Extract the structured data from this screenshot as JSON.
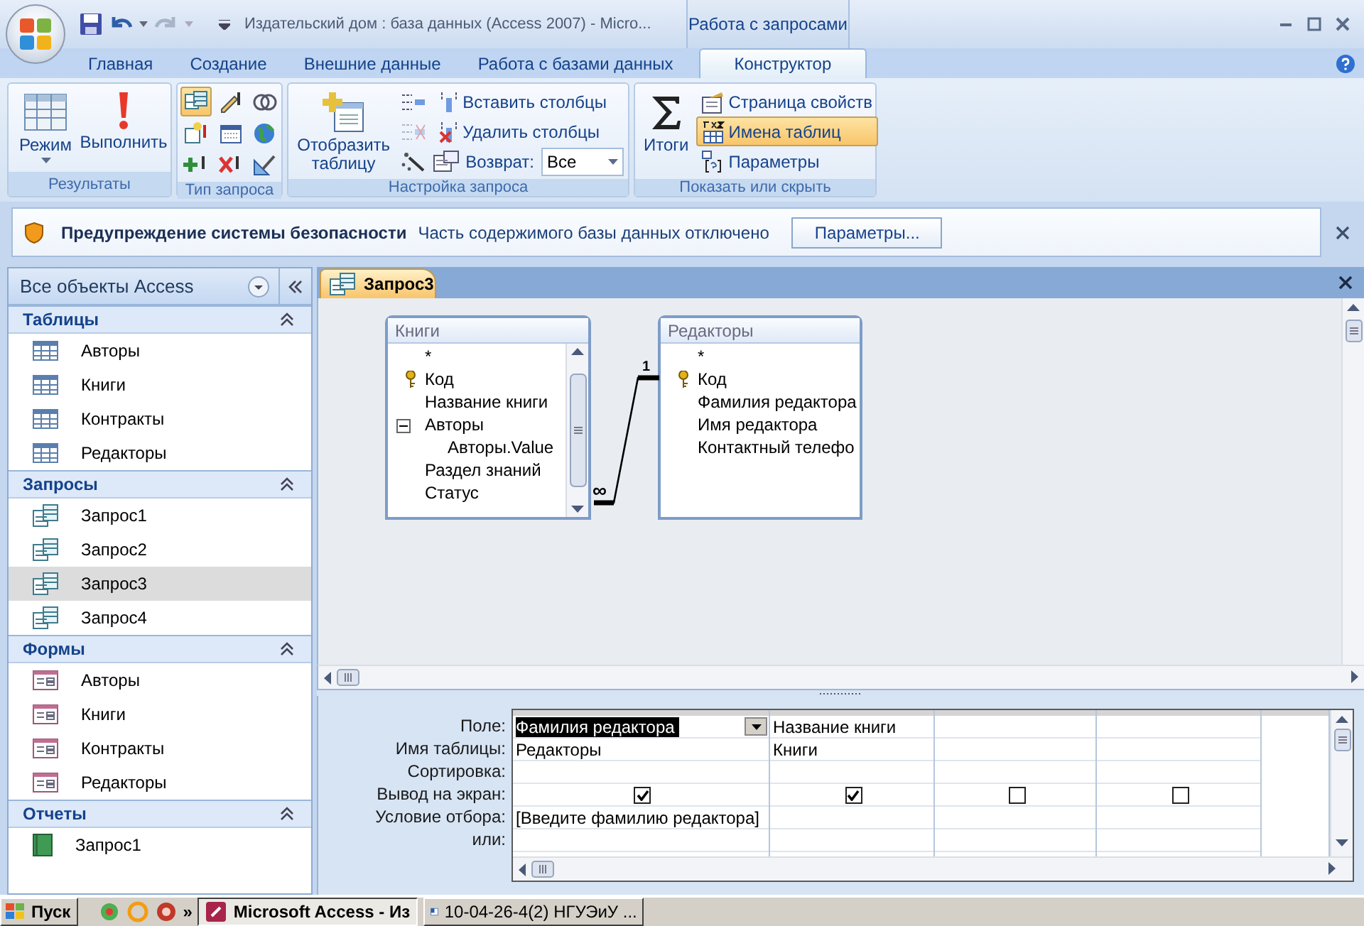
{
  "window": {
    "title": "Издательский дом : база данных (Access 2007) - Micro...",
    "context_group": "Работа с запросами"
  },
  "ribbon_tabs": [
    {
      "label": "Главная",
      "selected": false
    },
    {
      "label": "Создание",
      "selected": false
    },
    {
      "label": "Внешние данные",
      "selected": false
    },
    {
      "label": "Работа с базами данных",
      "selected": false
    },
    {
      "label": "Конструктор",
      "selected": true
    }
  ],
  "ribbon_groups": [
    {
      "kind": "results",
      "label": "Результаты",
      "buttons": [
        {
          "kind": "view",
          "label": "Режим"
        },
        {
          "kind": "run",
          "label": "Выполнить"
        }
      ]
    },
    {
      "kind": "query_type",
      "label": "Тип запроса",
      "icons": [
        {
          "selected": true
        },
        {
          "selected": false
        },
        {
          "selected": false
        },
        {
          "selected": false
        },
        {
          "selected": false
        },
        {
          "selected": false
        },
        {
          "selected": false
        },
        {
          "selected": false
        },
        {
          "selected": false
        }
      ]
    },
    {
      "kind": "setup",
      "label": "Настройка запроса",
      "large": "Отобразить таблицу",
      "rows": [
        {
          "label": "Вставить столбцы",
          "side_disabled": false
        },
        {
          "label": "Удалить столбцы",
          "side_disabled": true
        }
      ],
      "return_label": "Возврат:",
      "return_value": "Все"
    },
    {
      "kind": "show_hide",
      "label": "Показать или скрыть",
      "large": "Итоги",
      "items": [
        {
          "label": "Страница свойств",
          "selected": false
        },
        {
          "label": "Имена таблиц",
          "selected": true
        },
        {
          "label": "Параметры",
          "selected": false
        }
      ]
    }
  ],
  "security": {
    "title": "Предупреждение системы безопасности",
    "message": "Часть содержимого базы данных отключено",
    "button": "Параметры..."
  },
  "nav": {
    "title": "Все объекты Access",
    "groups": [
      {
        "kind": "table",
        "label": "Таблицы",
        "expanded": true,
        "items": [
          {
            "label": "Авторы",
            "selected": false
          },
          {
            "label": "Книги",
            "selected": false
          },
          {
            "label": "Контракты",
            "selected": false
          },
          {
            "label": "Редакторы",
            "selected": false
          }
        ]
      },
      {
        "kind": "query",
        "label": "Запросы",
        "expanded": true,
        "items": [
          {
            "label": "Запрос1",
            "selected": false
          },
          {
            "label": "Запрос2",
            "selected": false
          },
          {
            "label": "Запрос3",
            "selected": true
          },
          {
            "label": "Запрос4",
            "selected": false
          }
        ]
      },
      {
        "kind": "form",
        "label": "Формы",
        "expanded": true,
        "items": [
          {
            "label": "Авторы",
            "selected": false
          },
          {
            "label": "Книги",
            "selected": false
          },
          {
            "label": "Контракты",
            "selected": false
          },
          {
            "label": "Редакторы",
            "selected": false
          }
        ]
      },
      {
        "kind": "report",
        "label": "Отчеты",
        "expanded": true,
        "items": [
          {
            "label": "Запрос1",
            "selected": false
          }
        ]
      }
    ]
  },
  "document_tabs": [
    {
      "label": "Запрос3",
      "selected": true
    }
  ],
  "field_lists": [
    {
      "title": "Книги",
      "scrollable": true,
      "fields": [
        {
          "label": "*",
          "key": false
        },
        {
          "label": "Код",
          "key": true
        },
        {
          "label": "Название книги",
          "key": false
        },
        {
          "label": "Авторы",
          "key": false,
          "expanded": true,
          "children": [
            {
              "label": "Авторы.Value",
              "key": false
            }
          ]
        },
        {
          "label": "Раздел знаний",
          "key": false
        },
        {
          "label": "Статус",
          "key": false
        }
      ]
    },
    {
      "title": "Редакторы",
      "scrollable": false,
      "fields": [
        {
          "label": "*",
          "key": false
        },
        {
          "label": "Код",
          "key": true
        },
        {
          "label": "Фамилия редактора",
          "key": false
        },
        {
          "label": "Имя редактора",
          "key": false
        },
        {
          "label": "Контактный телефо",
          "key": false
        }
      ]
    }
  ],
  "relationship": {
    "one": "1",
    "many": "∞"
  },
  "design_grid": {
    "row_labels": [
      "Поле:",
      "Имя таблицы:",
      "Сортировка:",
      "Вывод на экран:",
      "Условие отбора:",
      "или:"
    ],
    "columns": [
      {
        "field": "Фамилия редактора",
        "table": "Редакторы",
        "show": true,
        "criteria": "[Введите фамилию редактора]",
        "selected": true
      },
      {
        "field": "Название книги",
        "table": "Книги",
        "show": true,
        "selected": false
      },
      {
        "show": false,
        "selected": false
      },
      {
        "show": false,
        "selected": false
      }
    ]
  },
  "taskbar": {
    "start": "Пуск",
    "more": "»",
    "tasks": [
      {
        "label": "Microsoft Access - Из",
        "selected": true
      },
      {
        "label": "10-04-26-4(2) НГУЭиУ ...",
        "selected": false
      }
    ]
  }
}
